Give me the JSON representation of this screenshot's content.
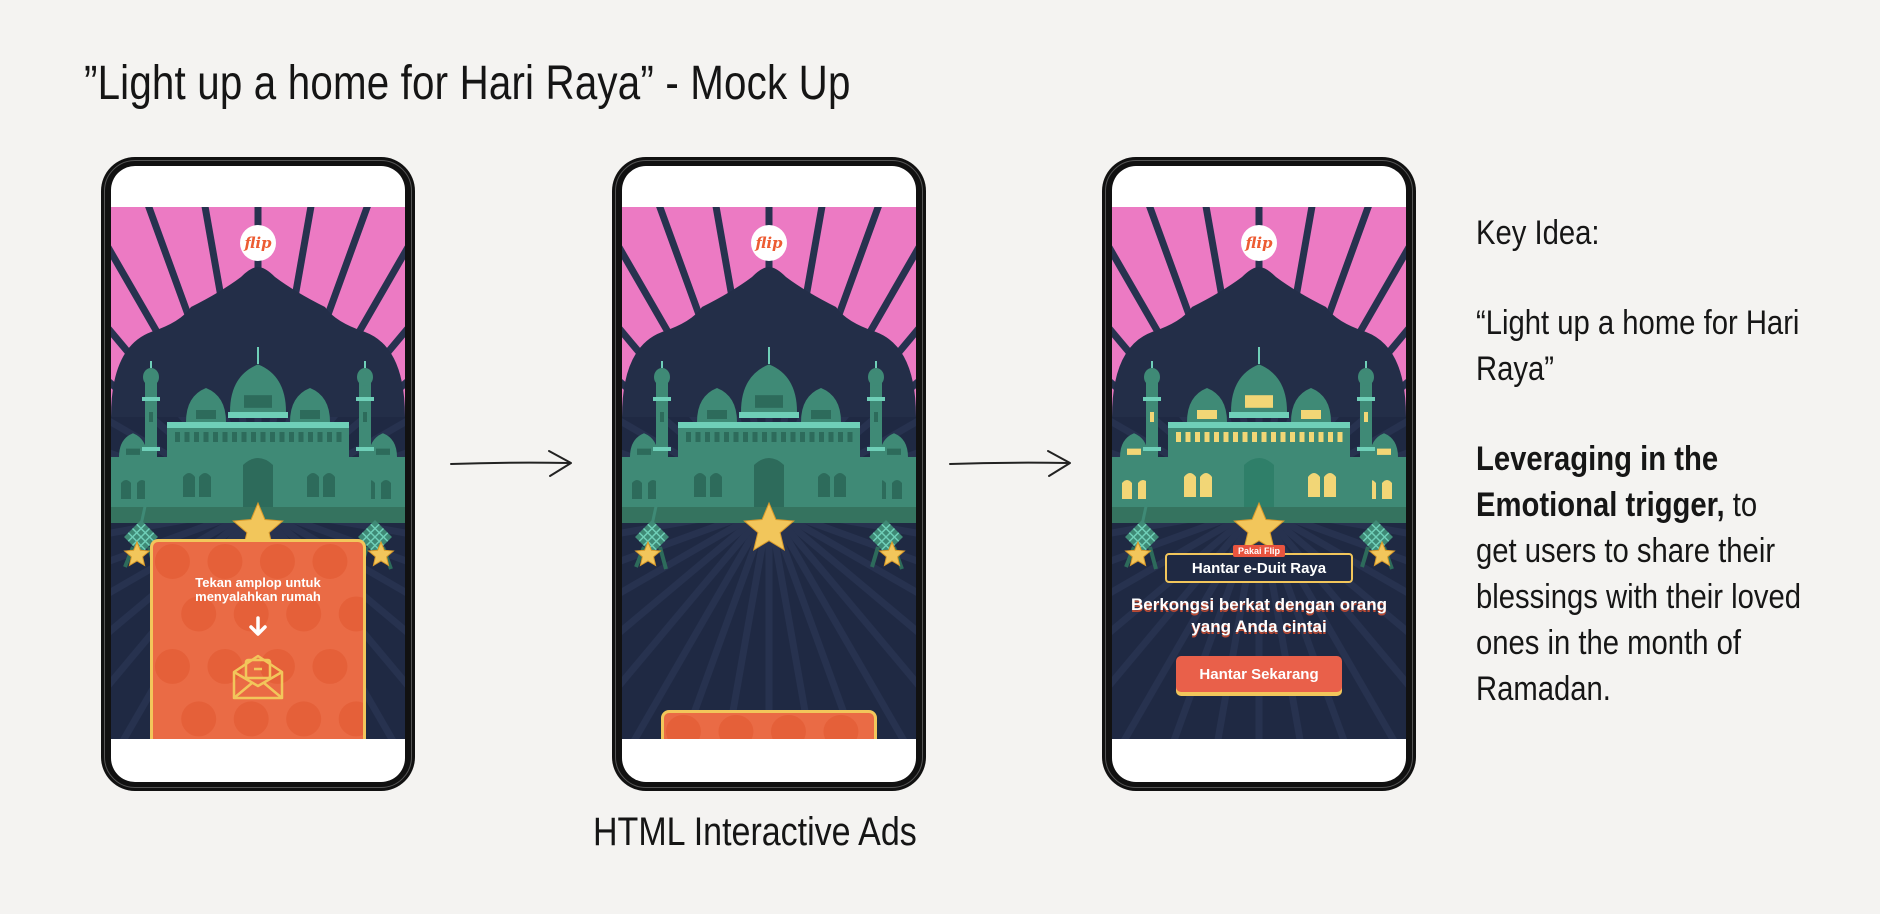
{
  "page": {
    "title": "”Light up a home for Hari Raya” - Mock Up",
    "caption": "HTML Interactive Ads"
  },
  "brand": {
    "logo_text": "flip",
    "colors": {
      "sky_pink": "#ec7ac3",
      "night_navy": "#1f2943",
      "mosque_green": "#3f8a76",
      "accent_orange": "#ea6b45",
      "gold": "#f2c65b"
    }
  },
  "screen1": {
    "instruction": "Tekan amplop untuk menyalahkan rumah",
    "arrow_icon": "arrow-down-icon",
    "envelope_icon": "envelope-icon"
  },
  "screen3": {
    "tag": "Pakai Flip",
    "box_label": "Hantar e-Duit Raya",
    "headline": "Berkongsi berkat dengan orang yang Anda cintai",
    "button_label": "Hantar Sekarang"
  },
  "key_idea": {
    "heading": "Key Idea:",
    "quote": "“Light up a home for Hari Raya”",
    "bold_lead": "Leveraging in the Emotional trigger,",
    "body": " to get users to share their blessings with their loved ones in the month of Ramadan."
  }
}
